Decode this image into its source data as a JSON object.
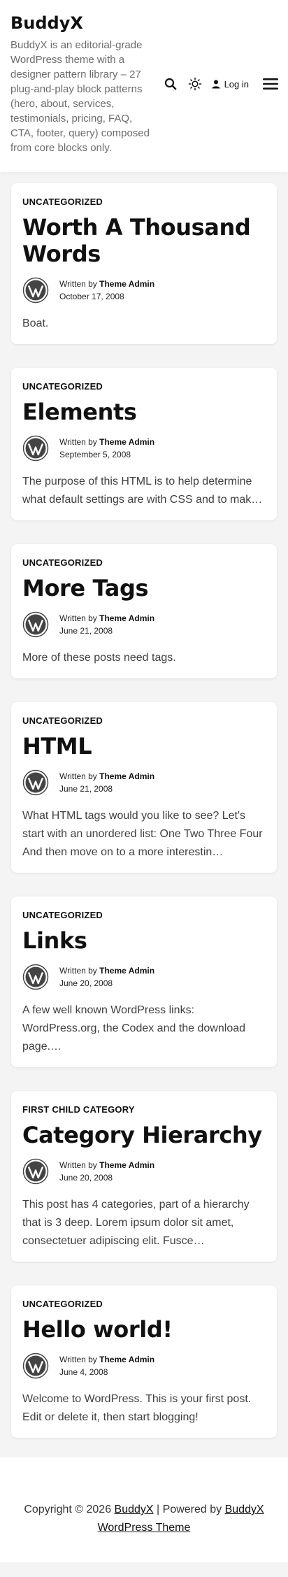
{
  "header": {
    "site_title": "BuddyX",
    "site_description": "BuddyX is an editorial-grade WordPress theme with a designer pattern library – 27 plug-and-play block patterns (hero, about, services, testimonials, pricing, FAQ, CTA, footer, query) composed from core blocks only.",
    "login_label": "Log in",
    "icons": {
      "search": "search-icon",
      "theme_toggle": "sun-icon",
      "user": "user-icon",
      "menu": "hamburger-menu-icon"
    }
  },
  "meta_labels": {
    "written_by": "Written by"
  },
  "posts": [
    {
      "category": "UNCATEGORIZED",
      "title": "Worth A Thousand Words",
      "author": "Theme Admin",
      "date": "October 17, 2008",
      "excerpt": "Boat."
    },
    {
      "category": "UNCATEGORIZED",
      "title": "Elements",
      "author": "Theme Admin",
      "date": "September 5, 2008",
      "excerpt": "The purpose of this HTML is to help determine what default settings are with CSS and to make sure that all possible HTML…"
    },
    {
      "category": "UNCATEGORIZED",
      "title": "More Tags",
      "author": "Theme Admin",
      "date": "June 21, 2008",
      "excerpt": "More of these posts need tags."
    },
    {
      "category": "UNCATEGORIZED",
      "title": "HTML",
      "author": "Theme Admin",
      "date": "June 21, 2008",
      "excerpt": "What HTML tags would you like to see? Let's start with an unordered list: One Two Three Four And then move on to a more interestin…"
    },
    {
      "category": "UNCATEGORIZED",
      "title": "Links",
      "author": "Theme Admin",
      "date": "June 20, 2008",
      "excerpt": "A few well known WordPress links: WordPress.org, the Codex and the download page.…"
    },
    {
      "category": "FIRST CHILD CATEGORY",
      "title": "Category Hierarchy",
      "author": "Theme Admin",
      "date": "June 20, 2008",
      "excerpt": "This post has 4 categories, part of a hierarchy that is 3 deep. Lorem ipsum dolor sit amet, consectetuer adipiscing elit. Fusce…"
    },
    {
      "category": "UNCATEGORIZED",
      "title": "Hello world!",
      "author": "Theme Admin",
      "date": "June 4, 2008",
      "excerpt": "Welcome to WordPress. This is your first post. Edit or delete it, then start blogging!"
    }
  ],
  "footer": {
    "copyright_prefix": "Copyright © 2026",
    "site_link": "BuddyX",
    "separator": "|",
    "powered_by": "Powered by",
    "theme_link": "BuddyX WordPress Theme"
  },
  "colors": {
    "background": "#f4f4f5",
    "card": "#ffffff",
    "text": "#111111",
    "muted": "#6b6b6b"
  }
}
